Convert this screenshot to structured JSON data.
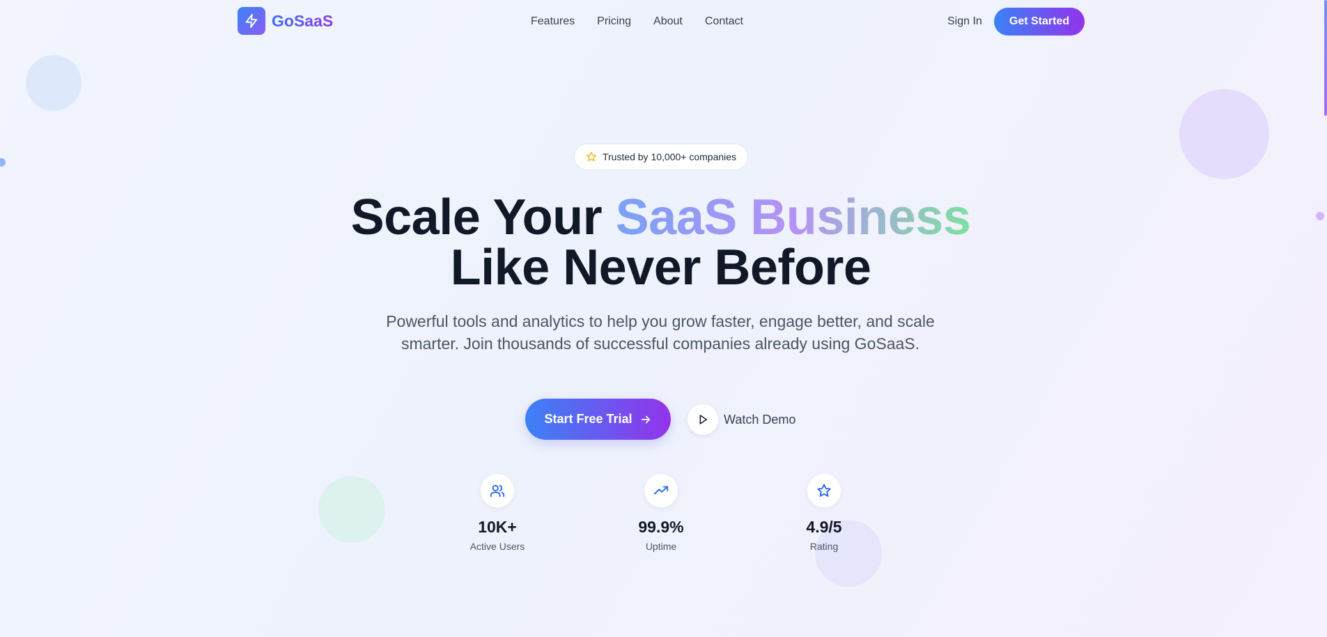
{
  "brand": {
    "name": "GoSaaS",
    "logo_icon": "lightning-bolt-icon"
  },
  "nav": {
    "links": [
      "Features",
      "Pricing",
      "About",
      "Contact"
    ],
    "sign_in": "Sign In",
    "get_started": "Get Started"
  },
  "hero": {
    "badge": {
      "icon": "star-icon",
      "text": "Trusted by 10,000+ companies"
    },
    "headline_part1": "Scale Your ",
    "headline_highlight": "SaaS Business",
    "headline_line2": "Like Never Before",
    "subheadline": "Powerful tools and analytics to help you grow faster, engage better, and scale smarter. Join thousands of successful companies already using GoSaaS.",
    "primary_cta": "Start Free Trial",
    "secondary_cta": "Watch Demo"
  },
  "stats": [
    {
      "icon": "users-icon",
      "value": "10K+",
      "label": "Active Users"
    },
    {
      "icon": "trending-up-icon",
      "value": "99.9%",
      "label": "Uptime"
    },
    {
      "icon": "star-icon",
      "value": "4.9/5",
      "label": "Rating"
    }
  ],
  "colors": {
    "brand_gradient_start": "#3b82f6",
    "brand_gradient_end": "#9333ea",
    "text_dark": "#111827",
    "text_muted": "#4b5563"
  }
}
